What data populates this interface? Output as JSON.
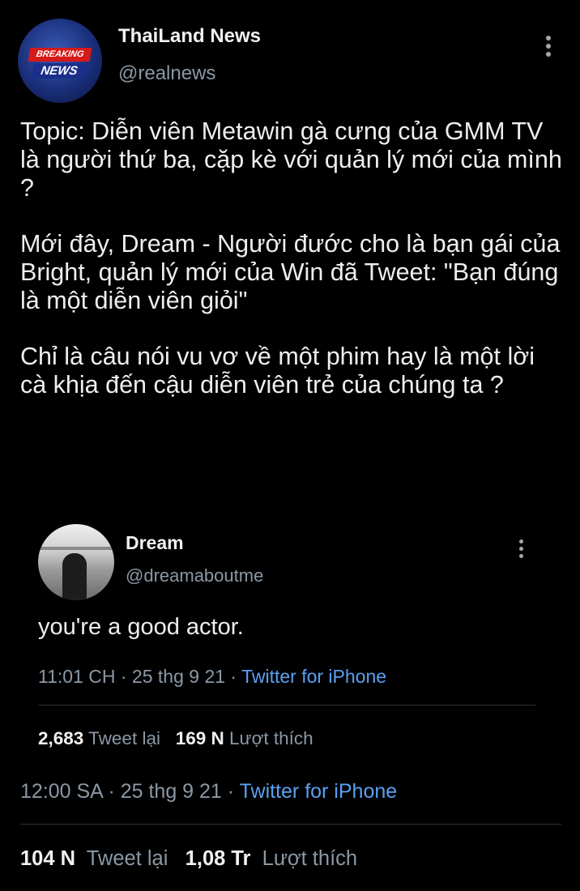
{
  "tweet": {
    "avatar": {
      "icon": "breaking-news-logo",
      "line1": "BREAKING",
      "line2": "NEWS"
    },
    "author_name": "ThaiLand News",
    "author_handle": "@realnews",
    "more_icon": "more-vertical-icon",
    "paragraphs": [
      "Topic: Diễn viên Metawin gà cưng của GMM TV là người thứ ba, cặp kè với quản lý mới của mình ?",
      "Mới đây, Dream - Người đước cho là bạn gái của Bright, quản lý mới của Win đã Tweet: \"Bạn đúng là một diễn viên giỏi\"",
      "Chỉ là câu nói vu vơ về một phim hay là một lời cà khịa đến cậu diễn viên trẻ của chúng ta ?"
    ],
    "time": "12:00 SA",
    "date": "25 thg 9 21",
    "source": "Twitter for iPhone",
    "retweets_count": "104 N",
    "retweets_label": "Tweet lại",
    "likes_count": "1,08 Tr",
    "likes_label": "Lượt thích"
  },
  "quote": {
    "author_name": "Dream",
    "author_handle": "@dreamaboutme",
    "text": "you're a good actor.",
    "time": "11:01 CH",
    "date": "25 thg 9 21",
    "source": "Twitter for iPhone",
    "retweets_count": "2,683",
    "retweets_label": "Tweet lại",
    "likes_count": "169 N",
    "likes_label": "Lượt thích"
  },
  "separator": "·",
  "colors": {
    "background": "#000000",
    "text": "#eeeeee",
    "muted": "#8b98a5",
    "link": "#5aa0f0",
    "badge_red": "#d61a1a",
    "badge_blue": "#1b2f8a"
  }
}
